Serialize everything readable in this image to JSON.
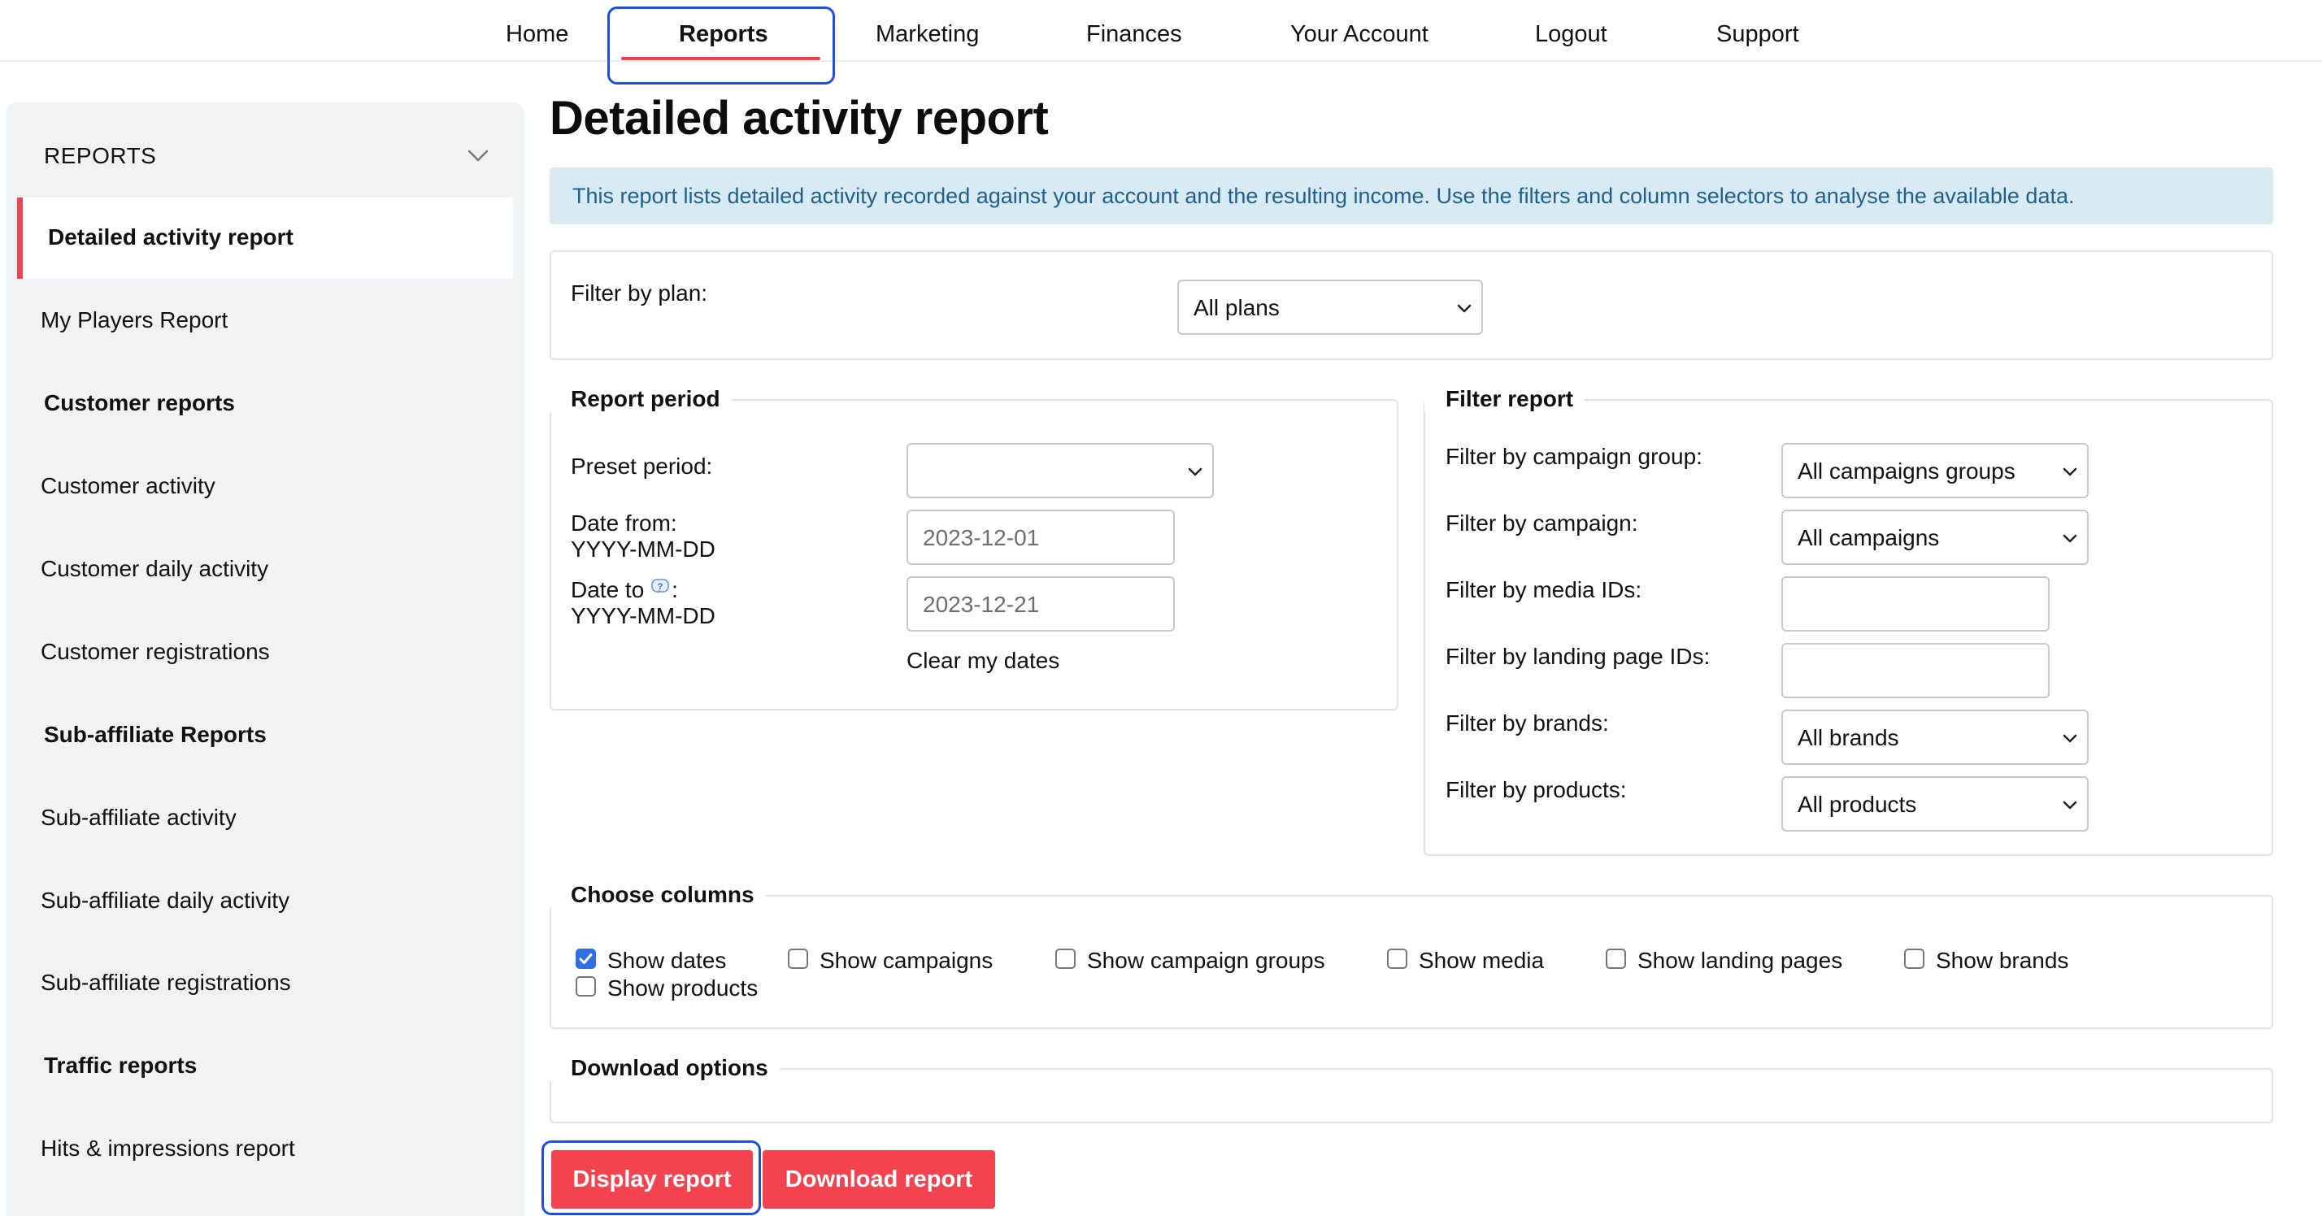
{
  "nav": {
    "items": [
      {
        "label": "Home"
      },
      {
        "label": "Reports"
      },
      {
        "label": "Marketing"
      },
      {
        "label": "Finances"
      },
      {
        "label": "Your Account"
      },
      {
        "label": "Logout"
      },
      {
        "label": "Support"
      }
    ],
    "active": "Reports"
  },
  "sidebar": {
    "heading": "REPORTS",
    "heading_icon": "chevron-down-icon",
    "active_item": "Detailed activity report",
    "items": [
      {
        "label": "My Players Report"
      },
      {
        "label": "Customer reports"
      },
      {
        "label": "Customer activity"
      },
      {
        "label": "Customer daily activity"
      },
      {
        "label": "Customer registrations"
      },
      {
        "label": "Sub-affiliate Reports"
      },
      {
        "label": "Sub-affiliate activity"
      },
      {
        "label": "Sub-affiliate daily activity"
      },
      {
        "label": "Sub-affiliate registrations"
      },
      {
        "label": "Traffic reports"
      },
      {
        "label": "Hits & impressions report"
      }
    ]
  },
  "page": {
    "title": "Detailed activity report",
    "info": "This report lists detailed activity recorded against your account and the resulting income. Use the filters and column selectors to analyse the available data."
  },
  "plan_filter": {
    "label": "Filter by plan:",
    "value": "All plans"
  },
  "report_period": {
    "legend": "Report period",
    "preset_label": "Preset period:",
    "preset_value": "",
    "date_from_label": "Date from:",
    "date_from_format": "YYYY-MM-DD",
    "date_from_value": "2023-12-01",
    "date_to_label": "Date to",
    "date_to_colon": ":",
    "date_to_format": "YYYY-MM-DD",
    "date_to_value": "2023-12-21",
    "help_icon": "help-icon",
    "clear_label": "Clear my dates"
  },
  "filter_report": {
    "legend": "Filter report",
    "campaign_group_label": "Filter by campaign group:",
    "campaign_group_value": "All campaigns groups",
    "campaign_label": "Filter by campaign:",
    "campaign_value": "All campaigns",
    "media_label": "Filter by media IDs:",
    "media_value": "",
    "landing_label": "Filter by landing page IDs:",
    "landing_value": "",
    "brands_label": "Filter by brands:",
    "brands_value": "All brands",
    "products_label": "Filter by products:",
    "products_value": "All products"
  },
  "columns": {
    "legend": "Choose columns",
    "options": [
      {
        "label": "Show dates",
        "checked": true
      },
      {
        "label": "Show campaigns",
        "checked": false
      },
      {
        "label": "Show campaign groups",
        "checked": false
      },
      {
        "label": "Show media",
        "checked": false
      },
      {
        "label": "Show landing pages",
        "checked": false
      },
      {
        "label": "Show brands",
        "checked": false
      },
      {
        "label": "Show products",
        "checked": false
      }
    ]
  },
  "download": {
    "legend": "Download options"
  },
  "actions": {
    "display_label": "Display report",
    "download_label": "Download report"
  },
  "colors": {
    "accent": "#f2434f",
    "focus_ring": "#1f4fe0",
    "info_bg": "#d8ebf4",
    "info_text": "#1f5f8b",
    "sidebar_bg": "#f1f2f4",
    "checkbox_checked": "#2f6fe4"
  }
}
